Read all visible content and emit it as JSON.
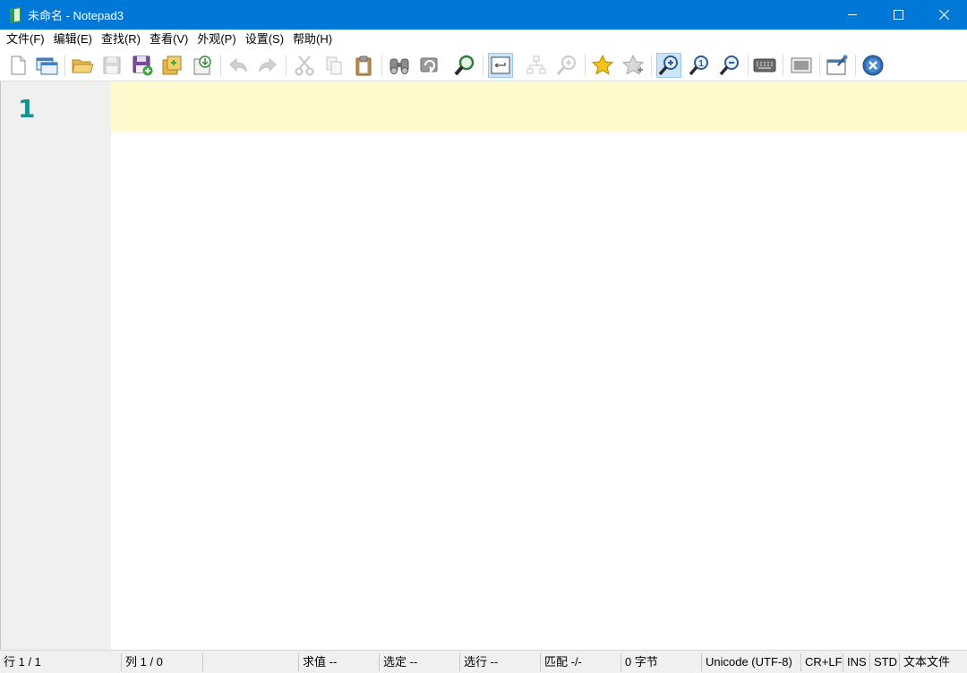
{
  "window": {
    "title": "未命名 - Notepad3",
    "controls": [
      "minimize-icon",
      "maximize-icon",
      "close-icon"
    ]
  },
  "menu": [
    {
      "label": "文件(F)"
    },
    {
      "label": "编辑(E)"
    },
    {
      "label": "查找(R)"
    },
    {
      "label": "查看(V)"
    },
    {
      "label": "外观(P)"
    },
    {
      "label": "设置(S)"
    },
    {
      "label": "帮助(H)"
    }
  ],
  "toolbar": {
    "buttons": [
      {
        "icon": "new-file-icon"
      },
      {
        "icon": "new-window-icon"
      },
      {
        "icon": "open-folder-icon"
      },
      {
        "icon": "save-icon",
        "disabled": true
      },
      {
        "icon": "save-as-icon"
      },
      {
        "icon": "save-copy-icon"
      },
      {
        "icon": "browse-icon"
      },
      {
        "icon": "undo-icon",
        "disabled": true
      },
      {
        "icon": "redo-icon",
        "disabled": true
      },
      {
        "icon": "cut-icon",
        "disabled": true
      },
      {
        "icon": "copy-icon",
        "disabled": true
      },
      {
        "icon": "paste-icon"
      },
      {
        "icon": "find-icon"
      },
      {
        "icon": "replace-icon"
      },
      {
        "icon": "find-next-icon"
      },
      {
        "icon": "word-wrap-icon",
        "active": true
      },
      {
        "icon": "fold-icon",
        "disabled": true
      },
      {
        "icon": "find-in-files-icon",
        "disabled": true
      },
      {
        "icon": "favorite-icon"
      },
      {
        "icon": "add-favorite-icon"
      },
      {
        "icon": "zoom-in-icon",
        "active": true
      },
      {
        "icon": "zoom-reset-icon"
      },
      {
        "icon": "zoom-out-icon"
      },
      {
        "icon": "keyboard-icon"
      },
      {
        "icon": "screen-icon"
      },
      {
        "icon": "pin-icon"
      },
      {
        "icon": "exit-icon"
      }
    ]
  },
  "editor": {
    "line_numbers": [
      "1"
    ],
    "content": ""
  },
  "status": {
    "line": "行  1 / 1",
    "column": "列  1 / 0",
    "sum": "求值  --",
    "selection": "选定  --",
    "selected_lines": "选行  --",
    "match": "匹配  -/-",
    "bytes": "0 字节",
    "encoding": "Unicode (UTF-8)",
    "eol": "CR+LF",
    "ovr": "INS",
    "mode": "STD",
    "doc_type": "文本文件"
  },
  "colors": {
    "titlebar": "#0078d7",
    "line_number": "#1a8f8f",
    "current_line": "#fffbcf",
    "gutter": "#f0f0f0"
  }
}
